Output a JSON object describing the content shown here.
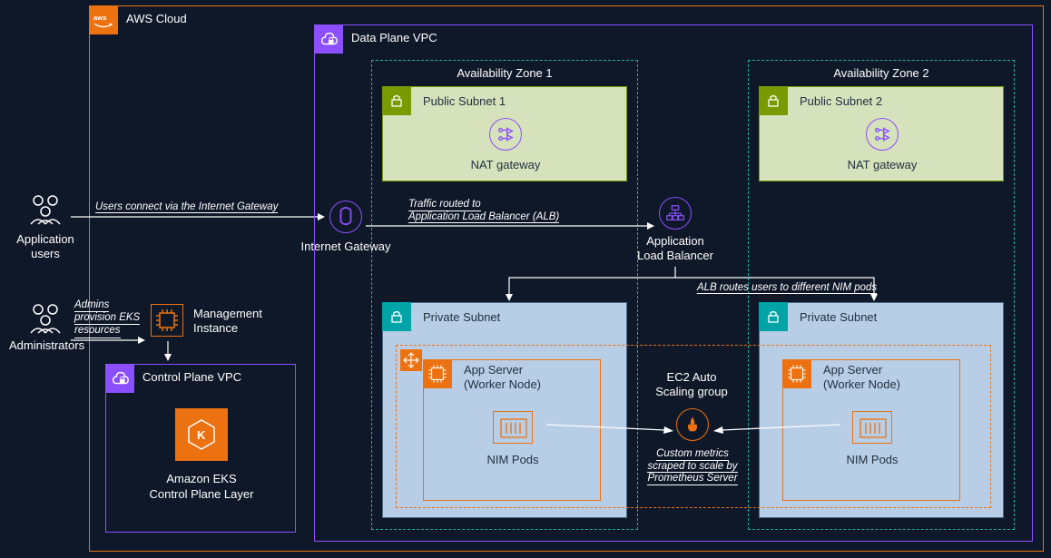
{
  "cloud": {
    "title": "AWS Cloud"
  },
  "users": {
    "app_label1": "Application",
    "app_label2": "users",
    "admin_label": "Administrators"
  },
  "edges": {
    "users_igw": "Users connect via the Internet Gateway",
    "admins_mgmt1": "Admins",
    "admins_mgmt2": "provision EKS",
    "admins_mgmt3": "resources",
    "traffic_alb1": "Traffic routed to",
    "traffic_alb2": "Application Load Balancer (ALB)",
    "alb_routes": "ALB routes users to different NIM pods",
    "metrics1": "Custom metrics",
    "metrics2": "scraped to scale by",
    "metrics3": "Prometheus Server"
  },
  "igw_label": "Internet Gateway",
  "mgmt1": "Management",
  "mgmt2": "Instance",
  "control_plane": {
    "title": "Control Plane VPC",
    "eks1": "Amazon EKS",
    "eks2": "Control Plane Layer"
  },
  "data_plane": {
    "title": "Data Plane VPC"
  },
  "az1": {
    "title": "Availability Zone 1",
    "pub_subnet": "Public Subnet 1",
    "nat": "NAT gateway",
    "priv_subnet": "Private Subnet"
  },
  "az2": {
    "title": "Availability Zone 2",
    "pub_subnet": "Public Subnet 2",
    "nat": "NAT gateway",
    "priv_subnet": "Private Subnet"
  },
  "alb1": "Application",
  "alb2": "Load Balancer",
  "asg1": "EC2 Auto",
  "asg2": "Scaling group",
  "worker1": "App Server",
  "worker2": "(Worker Node)",
  "nim": "NIM Pods"
}
